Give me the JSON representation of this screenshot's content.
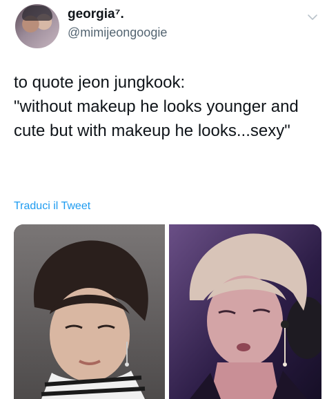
{
  "author": {
    "display_name": "georgia⁷.",
    "handle": "@mimijeongoogie"
  },
  "tweet": {
    "text": "to quote jeon jungkook:\n\"without makeup he looks younger and cute but with makeup he looks...sexy\"",
    "translate_link": "Traduci il Tweet"
  },
  "icons": {
    "more": "chevron-down-icon"
  },
  "colors": {
    "link": "#1d9bf0",
    "handle": "#536471",
    "text": "#0f1419"
  }
}
